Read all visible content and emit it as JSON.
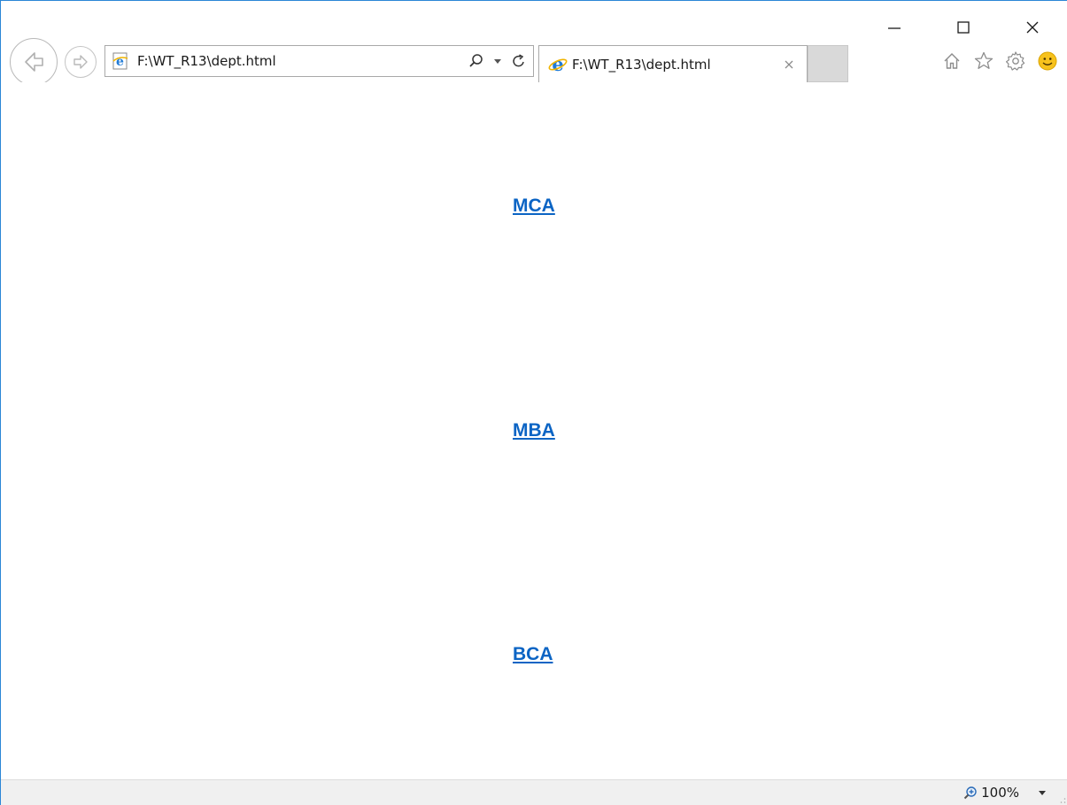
{
  "browser": {
    "address": "F:\\WT_R13\\dept.html",
    "tab_title": "F:\\WT_R13\\dept.html",
    "icons": {
      "back": "back-arrow-icon",
      "forward": "forward-arrow-icon",
      "search": "search-icon",
      "dropdown": "chevron-down-icon",
      "refresh": "refresh-icon",
      "close_tab": "close-icon",
      "home": "home-icon",
      "favorites": "star-icon",
      "tools": "gear-icon",
      "feedback": "smiley-icon"
    }
  },
  "window": {
    "minimize": "minimize-icon",
    "maximize": "maximize-icon",
    "close": "close-icon"
  },
  "page": {
    "links": [
      {
        "label": "MCA"
      },
      {
        "label": "MBA"
      },
      {
        "label": "BCA"
      }
    ]
  },
  "status": {
    "zoom": "100%"
  },
  "colors": {
    "link": "#0b64c4",
    "ie_blue": "#1f7ad6",
    "ie_gold": "#f0b400"
  }
}
